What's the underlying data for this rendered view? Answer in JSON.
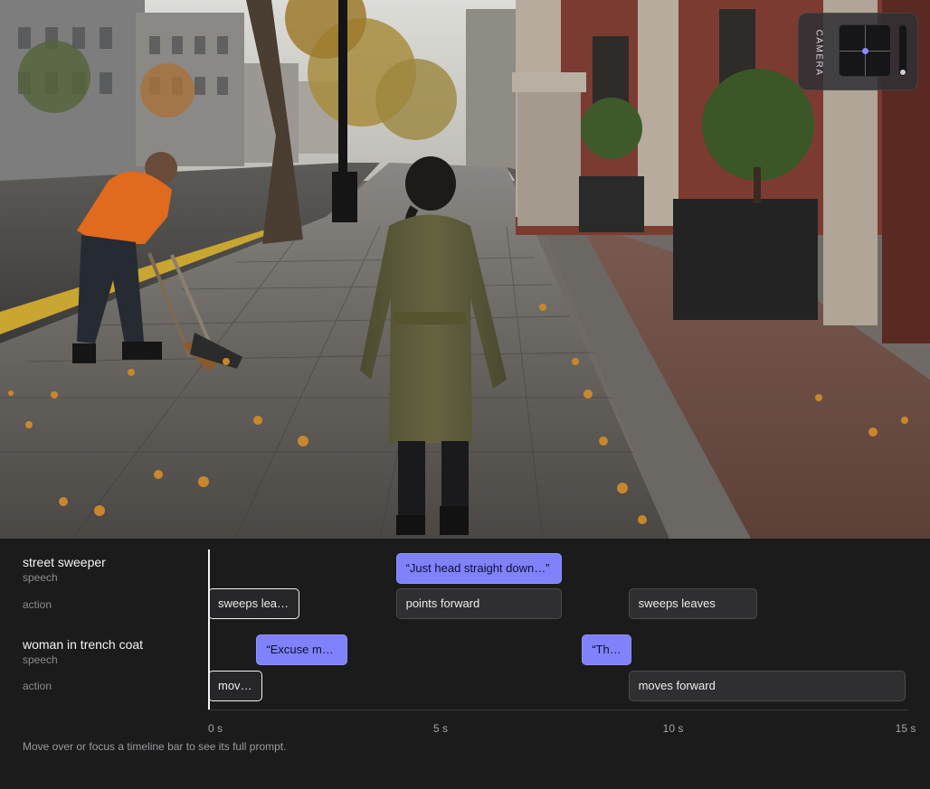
{
  "camera": {
    "label": "CAMERA",
    "pan": {
      "x": 0,
      "y": 0
    },
    "zoom_level": 0
  },
  "tracks": [
    {
      "name": "street sweeper",
      "speech_label": "speech",
      "action_label": "action",
      "speech": [
        {
          "text": "“Just head straight down…”",
          "start": 4,
          "end": 7.6
        }
      ],
      "actions": [
        {
          "text": "sweeps leav…",
          "start": 0,
          "end": 2
        },
        {
          "text": "points forward",
          "start": 4,
          "end": 7.6
        },
        {
          "text": "sweeps leaves",
          "start": 9,
          "end": 11.8
        }
      ]
    },
    {
      "name": "woman in trench coat",
      "speech_label": "speech",
      "action_label": "action",
      "speech": [
        {
          "text": "“Excuse me…”",
          "start": 1,
          "end": 3
        },
        {
          "text": "“Th…",
          "start": 8,
          "end": 9.1
        }
      ],
      "actions": [
        {
          "text": "moves",
          "start": 0,
          "end": 1.2
        },
        {
          "text": "moves forward",
          "start": 9,
          "end": 15
        }
      ]
    }
  ],
  "axis": {
    "ticks": [
      "0 s",
      "5 s",
      "10 s",
      "15 s"
    ],
    "min": 0,
    "max": 15
  },
  "hint": "Move over or focus a timeline bar to see its full prompt.",
  "colors": {
    "speech_bar": "#7f82fb",
    "action_bar": "#2f2f31",
    "panel_bg": "#1b1b1c"
  }
}
